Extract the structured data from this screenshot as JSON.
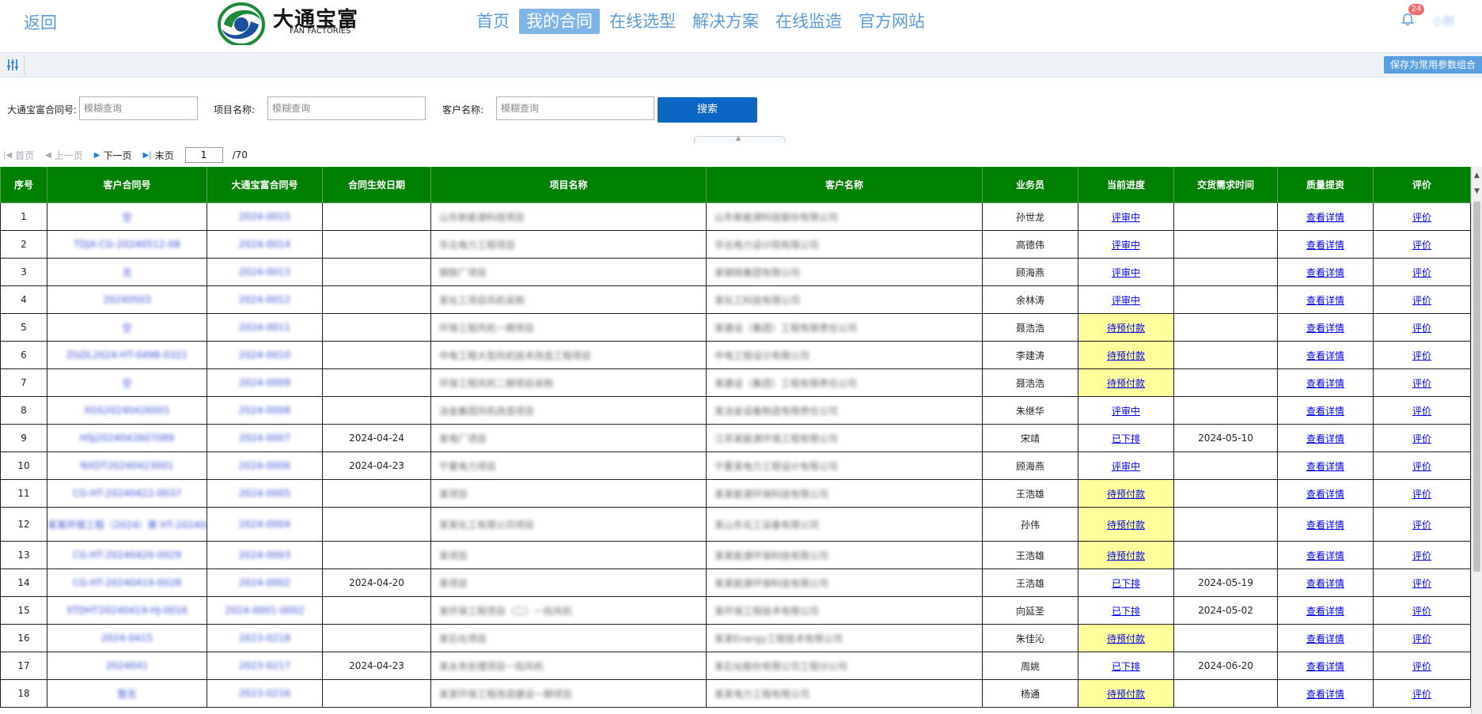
{
  "header": {
    "back": "返回",
    "logo_cn": "大通宝富",
    "logo_en": "FAN FACTORIES",
    "nav": [
      "首页",
      "我的合同",
      "在线选型",
      "解决方案",
      "在线监造",
      "官方网站"
    ],
    "active_nav": 1,
    "badge": "24",
    "user_name": "小明"
  },
  "toolbar": {
    "save_combo": "保存为常用参数组合"
  },
  "search": {
    "f1_label": "大通宝富合同号:",
    "f1_placeholder": "模糊查询",
    "f2_label": "项目名称:",
    "f2_placeholder": "模糊查询",
    "f3_label": "客户名称:",
    "f3_placeholder": "模糊查询",
    "button": "搜索"
  },
  "pager": {
    "first": "首页",
    "prev": "上一页",
    "next": "下一页",
    "last": "末页",
    "current": "1",
    "total": "/70"
  },
  "table": {
    "headers": [
      "序号",
      "客户合同号",
      "大通宝富合同号",
      "合同生效日期",
      "项目名称",
      "客户名称",
      "业务员",
      "当前进度",
      "交货需求时间",
      "质量提资",
      "评价"
    ],
    "rows": [
      {
        "idx": "1",
        "cust_no": "空",
        "dt_no": "2024-0015",
        "eff": "",
        "project": "山东新能源科技项目",
        "customer": "山东新能源科技股份有限公司",
        "sales": "孙世龙",
        "progress": "评审中",
        "yellow": false,
        "delivery": "",
        "quality": "查看详情",
        "eval": "评价"
      },
      {
        "idx": "2",
        "cust_no": "TDJX-CG-20240512-08",
        "dt_no": "2024-0014",
        "eff": "",
        "project": "华北电力工程项目",
        "customer": "华北电力设计院有限公司",
        "sales": "高德伟",
        "progress": "评审中",
        "yellow": false,
        "delivery": "",
        "quality": "查看详情",
        "eval": "评价"
      },
      {
        "idx": "3",
        "cust_no": "无",
        "dt_no": "2024-0013",
        "eff": "",
        "project": "钢铁厂项目",
        "customer": "某钢铁集团有限公司",
        "sales": "顾海燕",
        "progress": "评审中",
        "yellow": false,
        "delivery": "",
        "quality": "查看详情",
        "eval": "评价"
      },
      {
        "idx": "4",
        "cust_no": "20240503",
        "dt_no": "2024-0012",
        "eff": "",
        "project": "某化工项目风机采购",
        "customer": "某化工科技有限公司",
        "sales": "余林涛",
        "progress": "评审中",
        "yellow": false,
        "delivery": "",
        "quality": "查看详情",
        "eval": "评价"
      },
      {
        "idx": "5",
        "cust_no": "空",
        "dt_no": "2024-0011",
        "eff": "",
        "project": "环保工程风机一期项目",
        "customer": "某建设（集团）工程有限责任公司",
        "sales": "聂浩浩",
        "progress": "待预付款",
        "yellow": true,
        "delivery": "",
        "quality": "查看详情",
        "eval": "评价"
      },
      {
        "idx": "6",
        "cust_no": "ZGDL2024-HT-0498-0321",
        "dt_no": "2024-0010",
        "eff": "",
        "project": "中电工程大型风机技术改造工程项目",
        "customer": "中电工程设计有限公司",
        "sales": "李建涛",
        "progress": "待预付款",
        "yellow": true,
        "delivery": "",
        "quality": "查看详情",
        "eval": "评价"
      },
      {
        "idx": "7",
        "cust_no": "空",
        "dt_no": "2024-0009",
        "eff": "",
        "project": "环保工程风机二期项目采购",
        "customer": "某建设（集团）工程有限责任公司",
        "sales": "聂浩浩",
        "progress": "待预付款",
        "yellow": true,
        "delivery": "",
        "quality": "查看详情",
        "eval": "评价"
      },
      {
        "idx": "8",
        "cust_no": "XGS20240426001",
        "dt_no": "2024-0008",
        "eff": "",
        "project": "冶金集团风机改造项目",
        "customer": "某冶金设备制造有限责任公司",
        "sales": "朱继华",
        "progress": "评审中",
        "yellow": false,
        "delivery": "",
        "quality": "查看详情",
        "eval": "评价"
      },
      {
        "idx": "9",
        "cust_no": "HSJ2024042607089",
        "dt_no": "2024-0007",
        "eff": "2024-04-24",
        "project": "某电厂项目",
        "customer": "江苏某能源环境工程有限公司",
        "sales": "宋靖",
        "progress": "已下排",
        "yellow": false,
        "delivery": "2024-05-10",
        "quality": "查看详情",
        "eval": "评价"
      },
      {
        "idx": "10",
        "cust_no": "NXDT20240423001",
        "dt_no": "2024-0006",
        "eff": "2024-04-23",
        "project": "宁夏电力项目",
        "customer": "宁夏某电力工程设计有限公司",
        "sales": "顾海燕",
        "progress": "评审中",
        "yellow": false,
        "delivery": "",
        "quality": "查看详情",
        "eval": "评价"
      },
      {
        "idx": "11",
        "cust_no": "CG-HT-20240422-0037",
        "dt_no": "2024-0005",
        "eff": "",
        "project": "某项目",
        "customer": "某某能源环保科技有限公司",
        "sales": "王浩雄",
        "progress": "待预付款",
        "yellow": true,
        "delivery": "",
        "quality": "查看详情",
        "eval": "评价"
      },
      {
        "idx": "12",
        "cust_no": "某某环境工程（2024）第 HT-2024042201号",
        "dt_no": "2024-0004",
        "eff": "",
        "project": "某某化工有限公司项目",
        "customer": "某山东化工设备有限公司",
        "sales": "孙伟",
        "progress": "待预付款",
        "yellow": true,
        "delivery": "",
        "quality": "查看详情",
        "eval": "评价"
      },
      {
        "idx": "13",
        "cust_no": "CG-HT-20240420-0029",
        "dt_no": "2024-0003",
        "eff": "",
        "project": "某项目",
        "customer": "某某能源环保科技有限公司",
        "sales": "王浩雄",
        "progress": "待预付款",
        "yellow": true,
        "delivery": "",
        "quality": "查看详情",
        "eval": "评价"
      },
      {
        "idx": "14",
        "cust_no": "CG-HT-20240419-0028",
        "dt_no": "2024-0002",
        "eff": "2024-04-20",
        "project": "某项目",
        "customer": "某某能源环保科技有限公司",
        "sales": "王浩雄",
        "progress": "已下排",
        "yellow": false,
        "delivery": "2024-05-19",
        "quality": "查看详情",
        "eval": "评价"
      },
      {
        "idx": "15",
        "cust_no": "XTDHT20240419-HJ-0016",
        "dt_no": "2024-0001-0002",
        "eff": "",
        "project": "某环保工程项目（二）一段风机",
        "customer": "某环保工程技术有限公司",
        "sales": "向延圣",
        "progress": "已下排",
        "yellow": false,
        "delivery": "2024-05-02",
        "quality": "查看详情",
        "eval": "评价"
      },
      {
        "idx": "16",
        "cust_no": "2024-0415",
        "dt_no": "2023-0218",
        "eff": "",
        "project": "某石化项目",
        "customer": "某某Energy工程技术有限公司",
        "sales": "朱佳沁",
        "progress": "待预付款",
        "yellow": true,
        "delivery": "",
        "quality": "查看详情",
        "eval": "评价"
      },
      {
        "idx": "17",
        "cust_no": "2024041",
        "dt_no": "2023-0217",
        "eff": "2024-04-23",
        "project": "某水务处理项目一段风机",
        "customer": "某石化股份有限公司工程分公司",
        "sales": "周姚",
        "progress": "已下排",
        "yellow": false,
        "delivery": "2024-06-20",
        "quality": "查看详情",
        "eval": "评价"
      },
      {
        "idx": "18",
        "cust_no": "暂无",
        "dt_no": "2023-0216",
        "eff": "",
        "project": "某某环保工程改造建设一期项目",
        "customer": "某某电力工程有限公司",
        "sales": "杨通",
        "progress": "待预付款",
        "yellow": true,
        "delivery": "",
        "quality": "查看详情",
        "eval": "评价"
      }
    ]
  },
  "colors": {
    "header_green": "#008000",
    "accent_blue": "#5b9bd5",
    "pending_yellow": "#fefe9c",
    "search_button": "#0a66c2"
  }
}
